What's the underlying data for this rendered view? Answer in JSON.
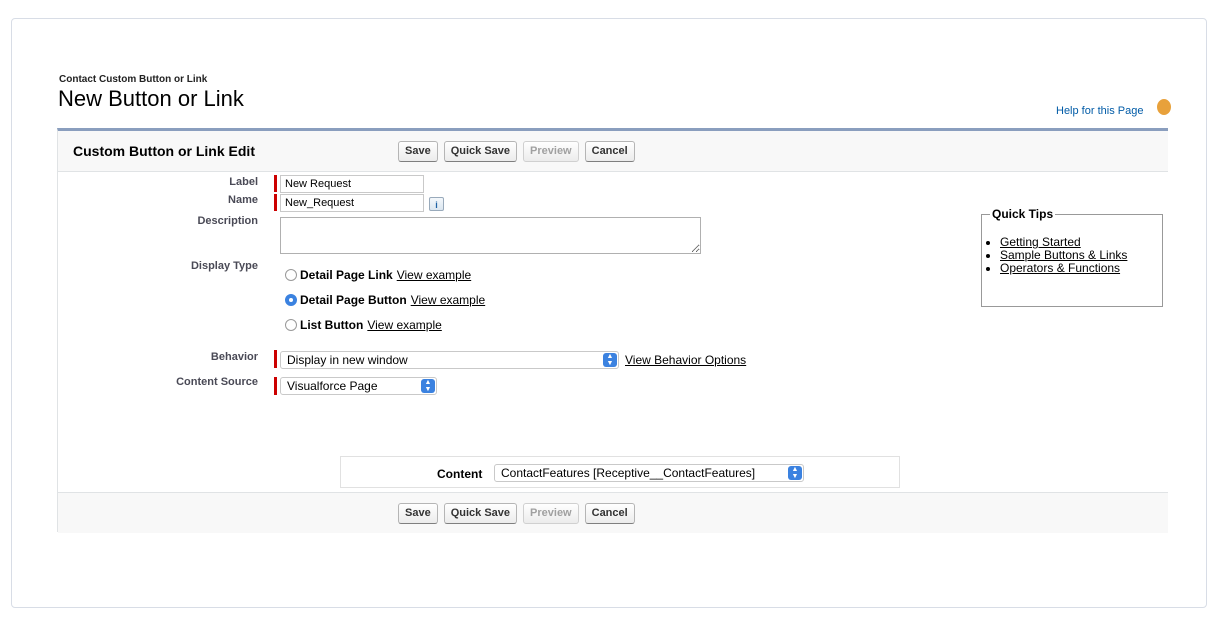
{
  "page": {
    "breadcrumb": "Contact Custom Button or Link",
    "title": "New Button or Link",
    "help_link": "Help for this Page"
  },
  "block": {
    "title": "Custom Button or Link Edit",
    "buttons": {
      "save": "Save",
      "quick_save": "Quick Save",
      "preview": "Preview",
      "cancel": "Cancel"
    }
  },
  "form": {
    "label": {
      "label": "Label",
      "value": "New Request"
    },
    "name": {
      "label": "Name",
      "value": "New_Request",
      "info": "i"
    },
    "description": {
      "label": "Description",
      "value": ""
    },
    "display_type": {
      "label": "Display Type",
      "options": [
        {
          "label": "Detail Page Link",
          "link": "View example",
          "checked": false
        },
        {
          "label": "Detail Page Button",
          "link": "View example",
          "checked": true
        },
        {
          "label": "List Button",
          "link": "View example",
          "checked": false
        }
      ]
    },
    "behavior": {
      "label": "Behavior",
      "value": "Display in new window",
      "link": "View Behavior Options"
    },
    "content_source": {
      "label": "Content Source",
      "value": "Visualforce Page"
    },
    "content": {
      "label": "Content",
      "value": "ContactFeatures [Receptive__ContactFeatures]"
    }
  },
  "quick_tips": {
    "title": "Quick Tips",
    "items": [
      "Getting Started",
      "Sample Buttons & Links",
      "Operators & Functions"
    ]
  },
  "colors": {
    "accent_blue": "#3b82e0",
    "required_red": "#cc0000",
    "header_border": "#8a9ebe",
    "help_icon": "#e8a13b"
  }
}
